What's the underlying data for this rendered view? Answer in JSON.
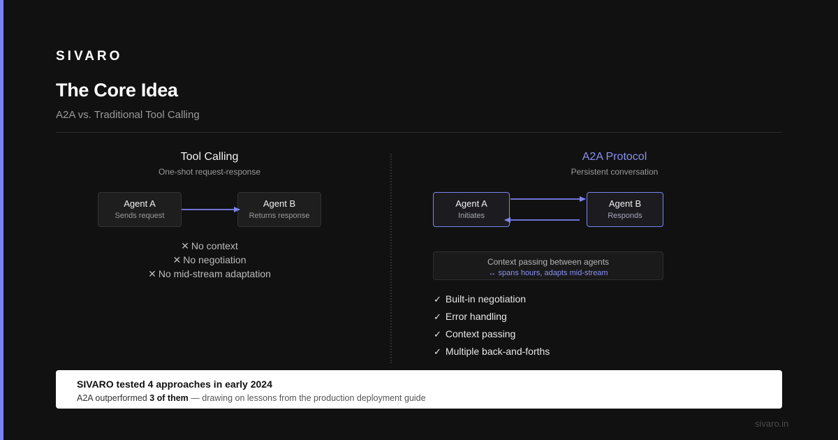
{
  "brand": "SIVARO",
  "title": "The Core Idea",
  "subtitle": "A2A vs. Traditional Tool Calling",
  "tool_calling": {
    "heading": "Tool Calling",
    "subheading": "One-shot request-response",
    "agent_a": {
      "name": "Agent A",
      "role": "Sends request"
    },
    "agent_b": {
      "name": "Agent B",
      "role": "Returns response"
    },
    "drawbacks": [
      "No context",
      "No negotiation",
      "No mid-stream adaptation"
    ]
  },
  "a2a": {
    "heading": "A2A Protocol",
    "subheading": "Persistent conversation",
    "agent_a": {
      "name": "Agent A",
      "role": "Initiates"
    },
    "agent_b": {
      "name": "Agent B",
      "role": "Responds"
    },
    "context_title": "Context passing between agents",
    "context_note": "↔ spans hours, adapts mid-stream",
    "benefits": [
      "Built-in negotiation",
      "Error handling",
      "Context passing",
      "Multiple back-and-forths"
    ]
  },
  "callout": {
    "headline": "SIVARO tested 4 approaches in early 2024",
    "body_prefix": "A2A outperformed ",
    "body_emphasis": "3 of them",
    "body_suffix": " — drawing on lessons from the production deployment guide"
  },
  "footer": "sivaro.in",
  "colors": {
    "accent": "#7c83f0",
    "background": "#111111",
    "callout_bg": "#ffffff"
  },
  "icons": {
    "negative": "x-mark-icon",
    "positive": "check-icon"
  }
}
